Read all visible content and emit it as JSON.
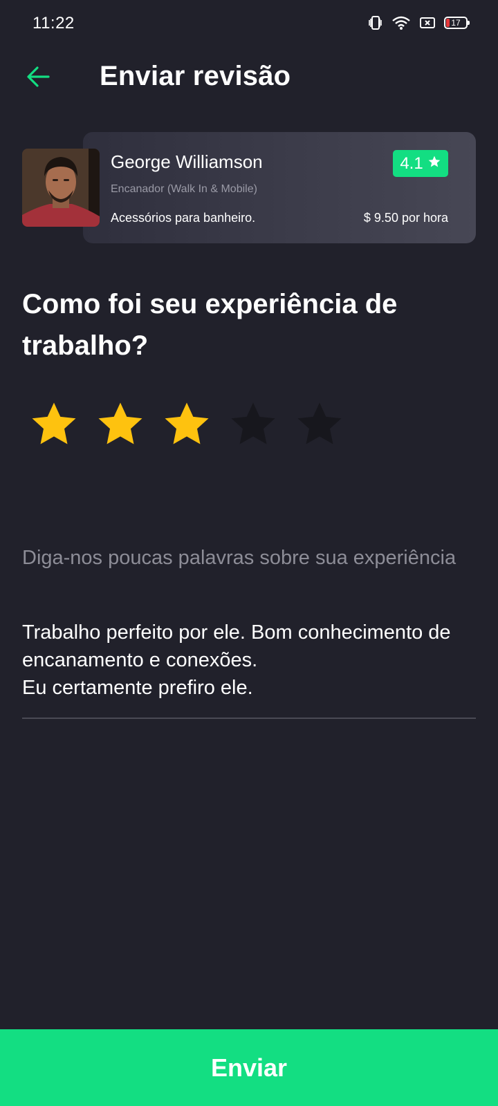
{
  "status_bar": {
    "time": "11:22",
    "battery_level": "17",
    "icons": [
      "vibrate-icon",
      "wifi-icon",
      "screen-record-icon",
      "battery-icon"
    ]
  },
  "header": {
    "title": "Enviar revisão",
    "back_icon": "arrow-left-icon"
  },
  "provider": {
    "name": "George Williamson",
    "role": "Encanador (Walk In & Mobile)",
    "service": "Acessórios para banheiro.",
    "price": "$ 9.50 por hora",
    "rating": "4.1"
  },
  "question": "Como foi seu experiência de trabalho?",
  "rating": {
    "selected": 3,
    "max": 5
  },
  "feedback": {
    "label": "Diga-nos poucas palavras sobre sua experiência",
    "text": "Trabalho perfeito por ele. Bom conhecimento de encanamento e conexões.\nEu certamente prefiro ele."
  },
  "submit_label": "Enviar",
  "colors": {
    "background": "#21212b",
    "accent": "#13de82",
    "star_active": "#fec20f",
    "star_inactive": "#17171d"
  }
}
